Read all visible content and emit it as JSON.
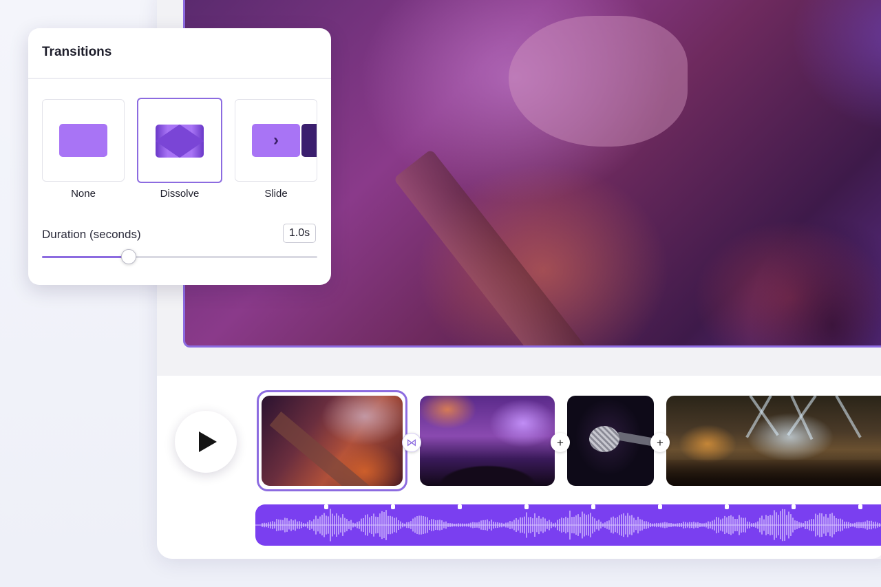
{
  "transitions_panel": {
    "title": "Transitions",
    "options": [
      {
        "label": "None",
        "icon": "no-transition-icon"
      },
      {
        "label": "Dissolve",
        "icon": "dissolve-icon",
        "selected": true
      },
      {
        "label": "Slide",
        "icon": "slide-icon"
      }
    ],
    "duration_label": "Duration (seconds)",
    "duration_value": "1.0s",
    "duration_slider_fraction": 0.315
  },
  "player": {
    "play_icon": "play-icon"
  },
  "timeline": {
    "clips": [
      {
        "name": "guitar-clip",
        "selected": true
      },
      {
        "name": "crowd-clip"
      },
      {
        "name": "microphone-clip"
      },
      {
        "name": "stage-lights-clip"
      }
    ],
    "connectors": [
      "bowtie-icon",
      "plus-icon",
      "plus-icon"
    ]
  },
  "colors": {
    "accent": "#8c6be0",
    "audio_track": "#7a3ff0",
    "transition_thumb": "#a874f5"
  }
}
